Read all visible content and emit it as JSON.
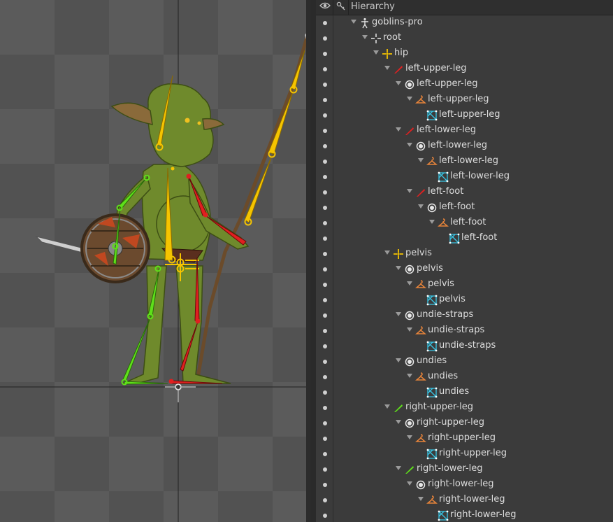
{
  "viewport": {
    "label": "viewport"
  },
  "hierarchy": {
    "title": "Hierarchy",
    "eye_icon": "eye-icon",
    "key_icon": "key-icon",
    "rows": [
      {
        "label": "goblins-pro",
        "depth": 0,
        "icon": "skeleton-icon",
        "expandable": true
      },
      {
        "label": "root",
        "depth": 1,
        "icon": "root-bone-icon",
        "expandable": true
      },
      {
        "label": "hip",
        "depth": 2,
        "icon": "bone-yellow-icon",
        "expandable": true
      },
      {
        "label": "left-upper-leg",
        "depth": 3,
        "icon": "bone-red-icon",
        "expandable": true
      },
      {
        "label": "left-upper-leg",
        "depth": 4,
        "icon": "slot-icon",
        "expandable": true
      },
      {
        "label": "left-upper-leg",
        "depth": 5,
        "icon": "skin-placeholder-icon",
        "expandable": true
      },
      {
        "label": "left-upper-leg",
        "depth": 6,
        "icon": "mesh-icon",
        "expandable": false
      },
      {
        "label": "left-lower-leg",
        "depth": 4,
        "icon": "bone-red-icon",
        "expandable": true
      },
      {
        "label": "left-lower-leg",
        "depth": 5,
        "icon": "slot-icon",
        "expandable": true
      },
      {
        "label": "left-lower-leg",
        "depth": 6,
        "icon": "skin-placeholder-icon",
        "expandable": true
      },
      {
        "label": "left-lower-leg",
        "depth": 7,
        "icon": "mesh-icon",
        "expandable": false
      },
      {
        "label": "left-foot",
        "depth": 5,
        "icon": "bone-red-icon",
        "expandable": true
      },
      {
        "label": "left-foot",
        "depth": 6,
        "icon": "slot-icon",
        "expandable": true
      },
      {
        "label": "left-foot",
        "depth": 7,
        "icon": "skin-placeholder-icon",
        "expandable": true
      },
      {
        "label": "left-foot",
        "depth": 8,
        "icon": "mesh-icon",
        "expandable": false
      },
      {
        "label": "pelvis",
        "depth": 3,
        "icon": "bone-yellow-icon",
        "expandable": true
      },
      {
        "label": "pelvis",
        "depth": 4,
        "icon": "slot-icon",
        "expandable": true
      },
      {
        "label": "pelvis",
        "depth": 5,
        "icon": "skin-placeholder-icon",
        "expandable": true
      },
      {
        "label": "pelvis",
        "depth": 6,
        "icon": "mesh-icon",
        "expandable": false
      },
      {
        "label": "undie-straps",
        "depth": 4,
        "icon": "slot-icon",
        "expandable": true
      },
      {
        "label": "undie-straps",
        "depth": 5,
        "icon": "skin-placeholder-icon",
        "expandable": true
      },
      {
        "label": "undie-straps",
        "depth": 6,
        "icon": "mesh-icon",
        "expandable": false
      },
      {
        "label": "undies",
        "depth": 4,
        "icon": "slot-icon",
        "expandable": true
      },
      {
        "label": "undies",
        "depth": 5,
        "icon": "skin-placeholder-icon",
        "expandable": true
      },
      {
        "label": "undies",
        "depth": 6,
        "icon": "mesh-icon",
        "expandable": false
      },
      {
        "label": "right-upper-leg",
        "depth": 3,
        "icon": "bone-green-icon",
        "expandable": true
      },
      {
        "label": "right-upper-leg",
        "depth": 4,
        "icon": "slot-icon",
        "expandable": true
      },
      {
        "label": "right-upper-leg",
        "depth": 5,
        "icon": "skin-placeholder-icon",
        "expandable": true
      },
      {
        "label": "right-upper-leg",
        "depth": 6,
        "icon": "mesh-icon",
        "expandable": false
      },
      {
        "label": "right-lower-leg",
        "depth": 4,
        "icon": "bone-green-icon",
        "expandable": true
      },
      {
        "label": "right-lower-leg",
        "depth": 5,
        "icon": "slot-icon",
        "expandable": true
      },
      {
        "label": "right-lower-leg",
        "depth": 6,
        "icon": "skin-placeholder-icon",
        "expandable": true
      },
      {
        "label": "right-lower-leg",
        "depth": 7,
        "icon": "mesh-icon",
        "expandable": false
      }
    ]
  },
  "colors": {
    "bone_yellow": "#f5c400",
    "bone_red": "#e02020",
    "bone_green": "#5fe01a",
    "slot": "#e8e8e8",
    "skin": "#e8843a",
    "mesh": "#38c8e8"
  }
}
